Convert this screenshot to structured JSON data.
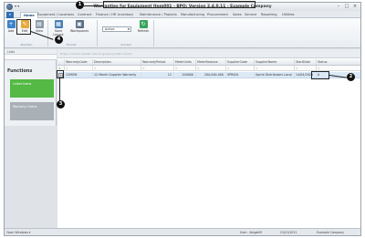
{
  "window": {
    "title": "Warranties for Equipment Item001 - BPO: Version 2.4.0.11 - Example Company",
    "quick_access": "▾ ▾",
    "controls": [
      "–",
      "□",
      "×"
    ]
  },
  "ribbon_tabs": [
    "Home",
    "Equipment / Locations",
    "Contract",
    "Finance / HR",
    "Inventory",
    "Maintenance / Projects",
    "Manufacturing",
    "Procurement",
    "Sales",
    "Service",
    "Reporting",
    "Utilities"
  ],
  "active_tab": "Home",
  "ribbon": {
    "buttons": {
      "add": "Add",
      "edit": "Edit",
      "view": "View",
      "save_layout": "Save Layout",
      "workspaces": "Workspaces",
      "refresh": "Refresh"
    },
    "status_select": "Active",
    "groups": {
      "maintain": "Maintain",
      "format": "Format",
      "current": "Current"
    }
  },
  "sidebar": {
    "header": "Links",
    "functions_title": "Functions",
    "tiles": [
      "Linked Items",
      "Warranty Claims"
    ]
  },
  "grid": {
    "group_hint": "Drag a column header here to group by that column",
    "columns": [
      "WarrantyCode",
      "Description",
      "WarrantyPeriod",
      "MeterUnits",
      "MeterBalance",
      "SupplierCode",
      "SupplierName",
      "StartDate",
      "Status"
    ],
    "rows": [
      {
        "WarrantyCode": "12MSW",
        "Description": "12 Month Supplier Warranty",
        "WarrantyPeriod": "12",
        "MeterUnits": "200000",
        "MeterBalance": "200,000.000",
        "SupplierCode": "SPR001",
        "SupplierName": "Sprint Distributors Local",
        "StartDate": "14/04/2020",
        "Status": "A"
      }
    ]
  },
  "statusbar": {
    "left": "Open Windows ▾",
    "user": "User : AbigailM",
    "date": "21/01/2021",
    "company": "Example Company"
  },
  "callouts": [
    "1",
    "2",
    "3",
    "4"
  ]
}
